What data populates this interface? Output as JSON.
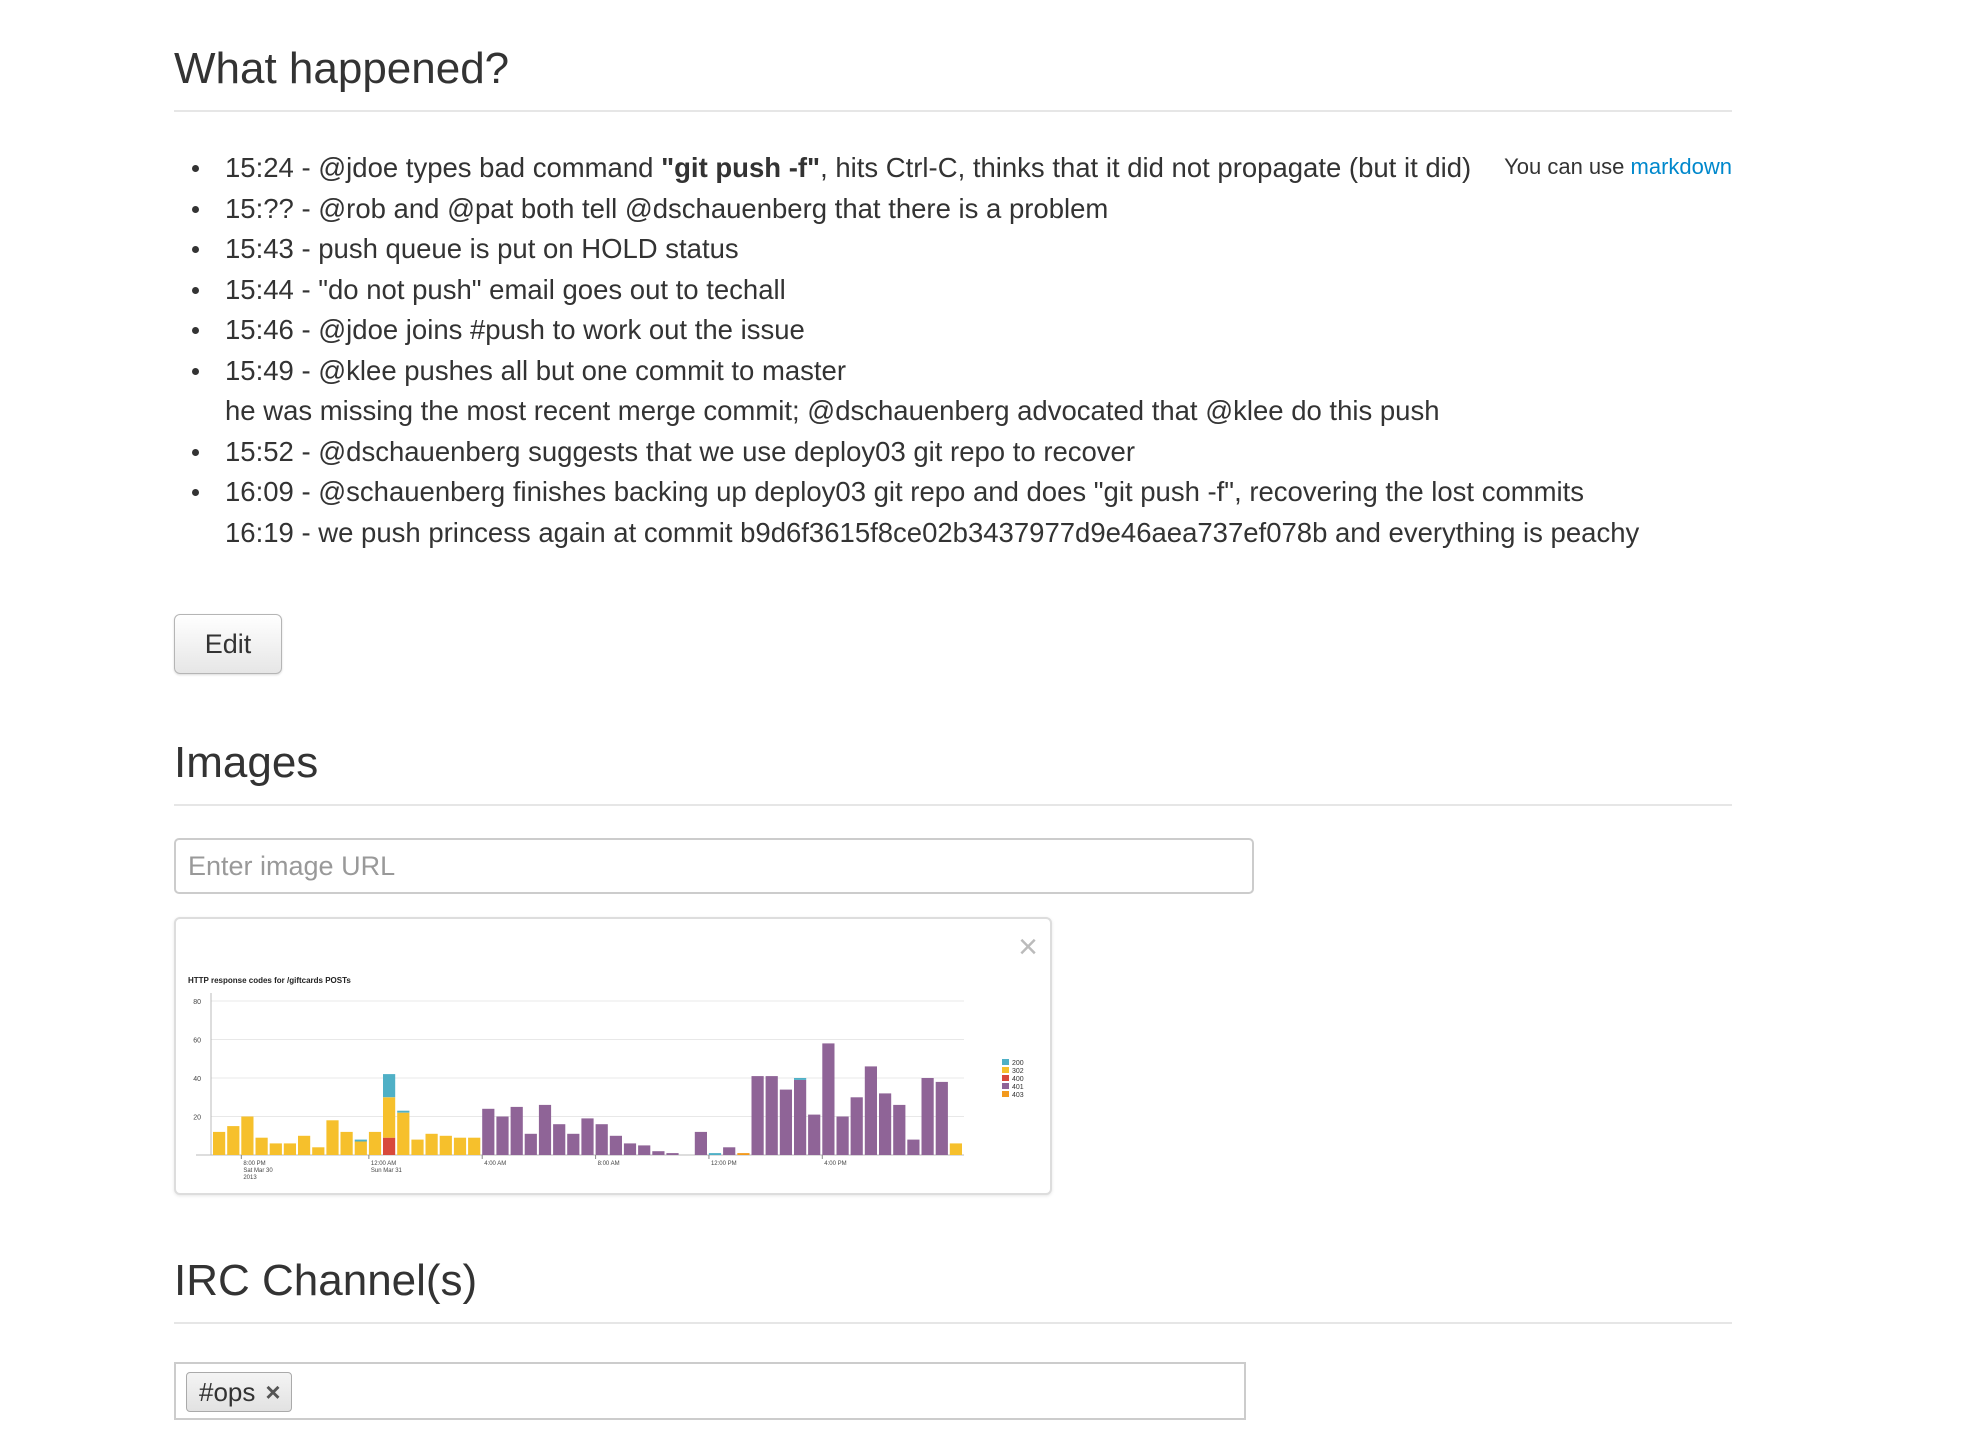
{
  "what_happened": {
    "title": "What happened?",
    "markdown_hint_prefix": "You can use",
    "markdown_link": "markdown",
    "events": [
      {
        "pre": "15:24 - @jdoe types bad command ",
        "bold": "\"git push -f\"",
        "post": ", hits Ctrl-C, thinks that it did not propagate (but it did)"
      },
      {
        "text": "15:?? - @rob and @pat both tell @dschauenberg that there is a problem"
      },
      {
        "text": "15:43 - push queue is put on HOLD status"
      },
      {
        "text": "15:44 - \"do not push\" email goes out to techall"
      },
      {
        "text": "15:46 - @jdoe joins #push to work out the issue"
      },
      {
        "text": "15:49 - @klee pushes all but one commit to master"
      },
      {
        "text": "he was missing the most recent merge commit; @dschauenberg advocated that @klee do this push"
      },
      {
        "text": "15:52 - @dschauenberg suggests that we use deploy03 git repo to recover"
      },
      {
        "text": "16:09 - @schauenberg finishes backing up deploy03 git repo and does \"git push -f\", recovering the lost commits"
      },
      {
        "text": "16:19 - we push princess again at commit b9d6f3615f8ce02b3437977d9e46aea737ef078b and everything is peachy"
      }
    ],
    "edit_label": "Edit"
  },
  "images": {
    "title": "Images",
    "url_placeholder": "Enter image URL",
    "url_value": "",
    "close_glyph": "×"
  },
  "chart_data": {
    "type": "bar",
    "title": "HTTP response codes for /giftcards POSTs",
    "xlabel": "",
    "ylabel": "",
    "ylim": [
      0,
      80
    ],
    "yticks": [
      20,
      40,
      60,
      80
    ],
    "x_tick_labels": [
      {
        "index": 2,
        "lines": [
          "8:00 PM",
          "Sat Mar 30",
          "2013"
        ]
      },
      {
        "index": 11,
        "lines": [
          "12:00 AM",
          "Sun Mar 31"
        ]
      },
      {
        "index": 19,
        "lines": [
          "4:00 AM"
        ]
      },
      {
        "index": 27,
        "lines": [
          "8:00 AM"
        ]
      },
      {
        "index": 35,
        "lines": [
          "12:00 PM"
        ]
      },
      {
        "index": 43,
        "lines": [
          "4:00 PM"
        ]
      }
    ],
    "legend": [
      {
        "name": "200",
        "color": "#4fb0c6"
      },
      {
        "name": "302",
        "color": "#f6c02c"
      },
      {
        "name": "400",
        "color": "#d8493b"
      },
      {
        "name": "401",
        "color": "#8f6497"
      },
      {
        "name": "403",
        "color": "#f39a1e"
      }
    ],
    "legend_position": "right",
    "series": [
      {
        "name": "200",
        "values": [
          0,
          0,
          0,
          0,
          0,
          0,
          0,
          0,
          0,
          0,
          1,
          0,
          12,
          1,
          0,
          0,
          0,
          0,
          0,
          0,
          0,
          0,
          0,
          0,
          0,
          0,
          0,
          0,
          0,
          0,
          0,
          0,
          0,
          0,
          0,
          1,
          0,
          0,
          0,
          0,
          0,
          1,
          0,
          0,
          0,
          0,
          0,
          0,
          0,
          0,
          0,
          0,
          0
        ]
      },
      {
        "name": "302",
        "values": [
          12,
          15,
          20,
          9,
          6,
          6,
          10,
          4,
          18,
          12,
          7,
          12,
          21,
          22,
          8,
          11,
          10,
          9,
          9,
          0,
          0,
          0,
          0,
          0,
          0,
          0,
          0,
          0,
          0,
          0,
          0,
          0,
          0,
          0,
          0,
          0,
          0,
          0,
          0,
          0,
          0,
          0,
          0,
          0,
          0,
          0,
          0,
          0,
          0,
          0,
          0,
          0,
          6
        ]
      },
      {
        "name": "400",
        "values": [
          0,
          0,
          0,
          0,
          0,
          0,
          0,
          0,
          0,
          0,
          0,
          0,
          9,
          0,
          0,
          0,
          0,
          0,
          0,
          0,
          0,
          0,
          0,
          0,
          0,
          0,
          0,
          0,
          0,
          0,
          0,
          0,
          0,
          0,
          0,
          0,
          0,
          0,
          0,
          0,
          0,
          0,
          0,
          0,
          0,
          0,
          0,
          0,
          0,
          0,
          0,
          0,
          0
        ]
      },
      {
        "name": "401",
        "values": [
          0,
          0,
          0,
          0,
          0,
          0,
          0,
          0,
          0,
          0,
          0,
          0,
          0,
          0,
          0,
          0,
          0,
          0,
          0,
          24,
          20,
          25,
          11,
          26,
          16,
          11,
          19,
          16,
          10,
          6,
          5,
          2,
          1,
          0,
          12,
          0,
          4,
          0,
          41,
          41,
          34,
          39,
          21,
          58,
          20,
          30,
          46,
          32,
          26,
          8,
          40,
          38,
          0
        ]
      },
      {
        "name": "403",
        "values": [
          0,
          0,
          0,
          0,
          0,
          0,
          0,
          0,
          0,
          0,
          0,
          0,
          0,
          0,
          0,
          0,
          0,
          0,
          0,
          0,
          0,
          0,
          0,
          0,
          0,
          0,
          0,
          0,
          0,
          0,
          0,
          0,
          0,
          0,
          0,
          0,
          0,
          1,
          0,
          0,
          0,
          0,
          0,
          0,
          0,
          0,
          0,
          0,
          0,
          0,
          0,
          0,
          0
        ]
      }
    ]
  },
  "irc": {
    "title": "IRC Channel(s)",
    "tags": [
      "#ops"
    ],
    "tag_remove_glyph": "×"
  }
}
